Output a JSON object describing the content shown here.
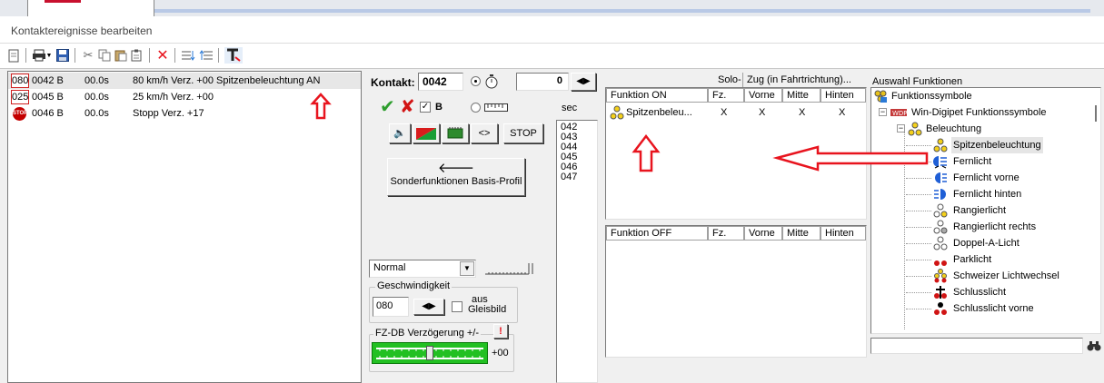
{
  "window": {
    "title": "Kontaktereignisse bearbeiten"
  },
  "contacts": [
    {
      "speed": "080",
      "code": "0042 B",
      "time": "00.0s",
      "desc": "80 km/h Verz. +00 Spitzenbeleuchtung AN",
      "selected": true
    },
    {
      "speed": "025",
      "code": "0045 B",
      "time": "00.0s",
      "desc": "25 km/h Verz. +00",
      "selected": false
    },
    {
      "speed": "STOP",
      "code": "0046 B",
      "time": "00.0s",
      "desc": "Stopp Verz. +17",
      "selected": false
    }
  ],
  "kontakt": {
    "label": "Kontakt:",
    "value": "0042",
    "counter": "0",
    "b_label": "B",
    "sec_label": "sec",
    "lr_label": "<>",
    "stop_label": "STOP",
    "sonder_label": "Sonderfunktionen Basis-Profil",
    "numbers": [
      "042",
      "043",
      "044",
      "045",
      "046",
      "047"
    ]
  },
  "mode": {
    "selected": "Normal"
  },
  "speed": {
    "group_label": "Geschwindigkeit",
    "value": "080",
    "check1": "aus",
    "check2": "Gleisbild"
  },
  "fzdb": {
    "label": "FZ-DB Verzögerung +/-",
    "value": "+00",
    "level": 0.5
  },
  "functions": {
    "solo_label": "Solo-",
    "zug_label": "Zug (in Fahrtrichtung)...",
    "on_header": "Funktion ON",
    "off_header": "Funktion OFF",
    "cols": [
      "Fz.",
      "Vorne",
      "Mitte",
      "Hinten"
    ],
    "on_rows": [
      {
        "name": "Spitzenbeleu...",
        "marks": [
          "X",
          "X",
          "X",
          "X"
        ]
      }
    ]
  },
  "tree": {
    "header": "Auswahl Funktionen",
    "root": "Funktionssymbole",
    "child": "Win-Digipet Funktionssymbole",
    "group": "Beleuchtung",
    "items": [
      {
        "label": "Spitzenbeleuchtung",
        "icon": "spitzen-icon",
        "selected": true
      },
      {
        "label": "Fernlicht",
        "icon": "fernlicht-icon"
      },
      {
        "label": "Fernlicht vorne",
        "icon": "fernlicht-vorne-icon"
      },
      {
        "label": "Fernlicht hinten",
        "icon": "fernlicht-hinten-icon"
      },
      {
        "label": "Rangierlicht",
        "icon": "rangierlicht-icon"
      },
      {
        "label": "Rangierlicht rechts",
        "icon": "rangierlicht-rechts-icon"
      },
      {
        "label": "Doppel-A-Licht",
        "icon": "doppel-a-icon"
      },
      {
        "label": "Parklicht",
        "icon": "parklicht-icon"
      },
      {
        "label": "Schweizer Lichtwechsel",
        "icon": "schweizer-icon"
      },
      {
        "label": "Schlusslicht",
        "icon": "schlusslicht-icon"
      },
      {
        "label": "Schlusslicht vorne",
        "icon": "schlusslicht-vorne-icon"
      }
    ]
  },
  "colors": {
    "accent_red": "#e8141e",
    "stop_red": "#c40000",
    "check_green": "#2e9e2e",
    "cross_red": "#d21414",
    "slider_green": "#22c022"
  }
}
